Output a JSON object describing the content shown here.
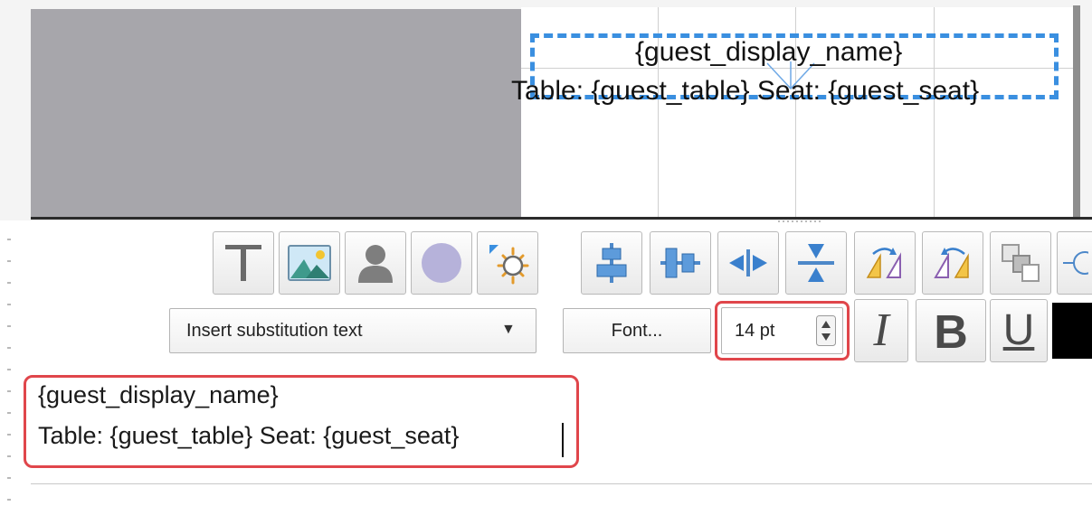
{
  "canvas": {
    "line1": "{guest_display_name}",
    "line2": "Table: {guest_table} Seat: {guest_seat}"
  },
  "toolbar": {
    "substitution_dropdown": "Insert substitution text",
    "font_button": "Font...",
    "font_size": "14 pt",
    "italic": "I",
    "bold": "B",
    "underline": "U"
  },
  "editor": {
    "line1": "{guest_display_name}",
    "line2": "Table: {guest_table} Seat: {guest_seat}"
  },
  "icons": {
    "insert_tools": [
      "text-icon",
      "image-icon",
      "person-icon",
      "circle-icon",
      "gear-icon"
    ],
    "layout_tools": [
      "align-center-horizontal-icon",
      "align-center-vertical-icon",
      "compress-horizontal-icon",
      "compress-vertical-icon",
      "rotate-right-icon",
      "rotate-left-icon",
      "bring-forward-icon",
      "crosshair-icon"
    ]
  },
  "colors": {
    "selection_border": "#3a8fe0",
    "highlight": "#e0464b",
    "text_color_swatch": "#000000"
  }
}
